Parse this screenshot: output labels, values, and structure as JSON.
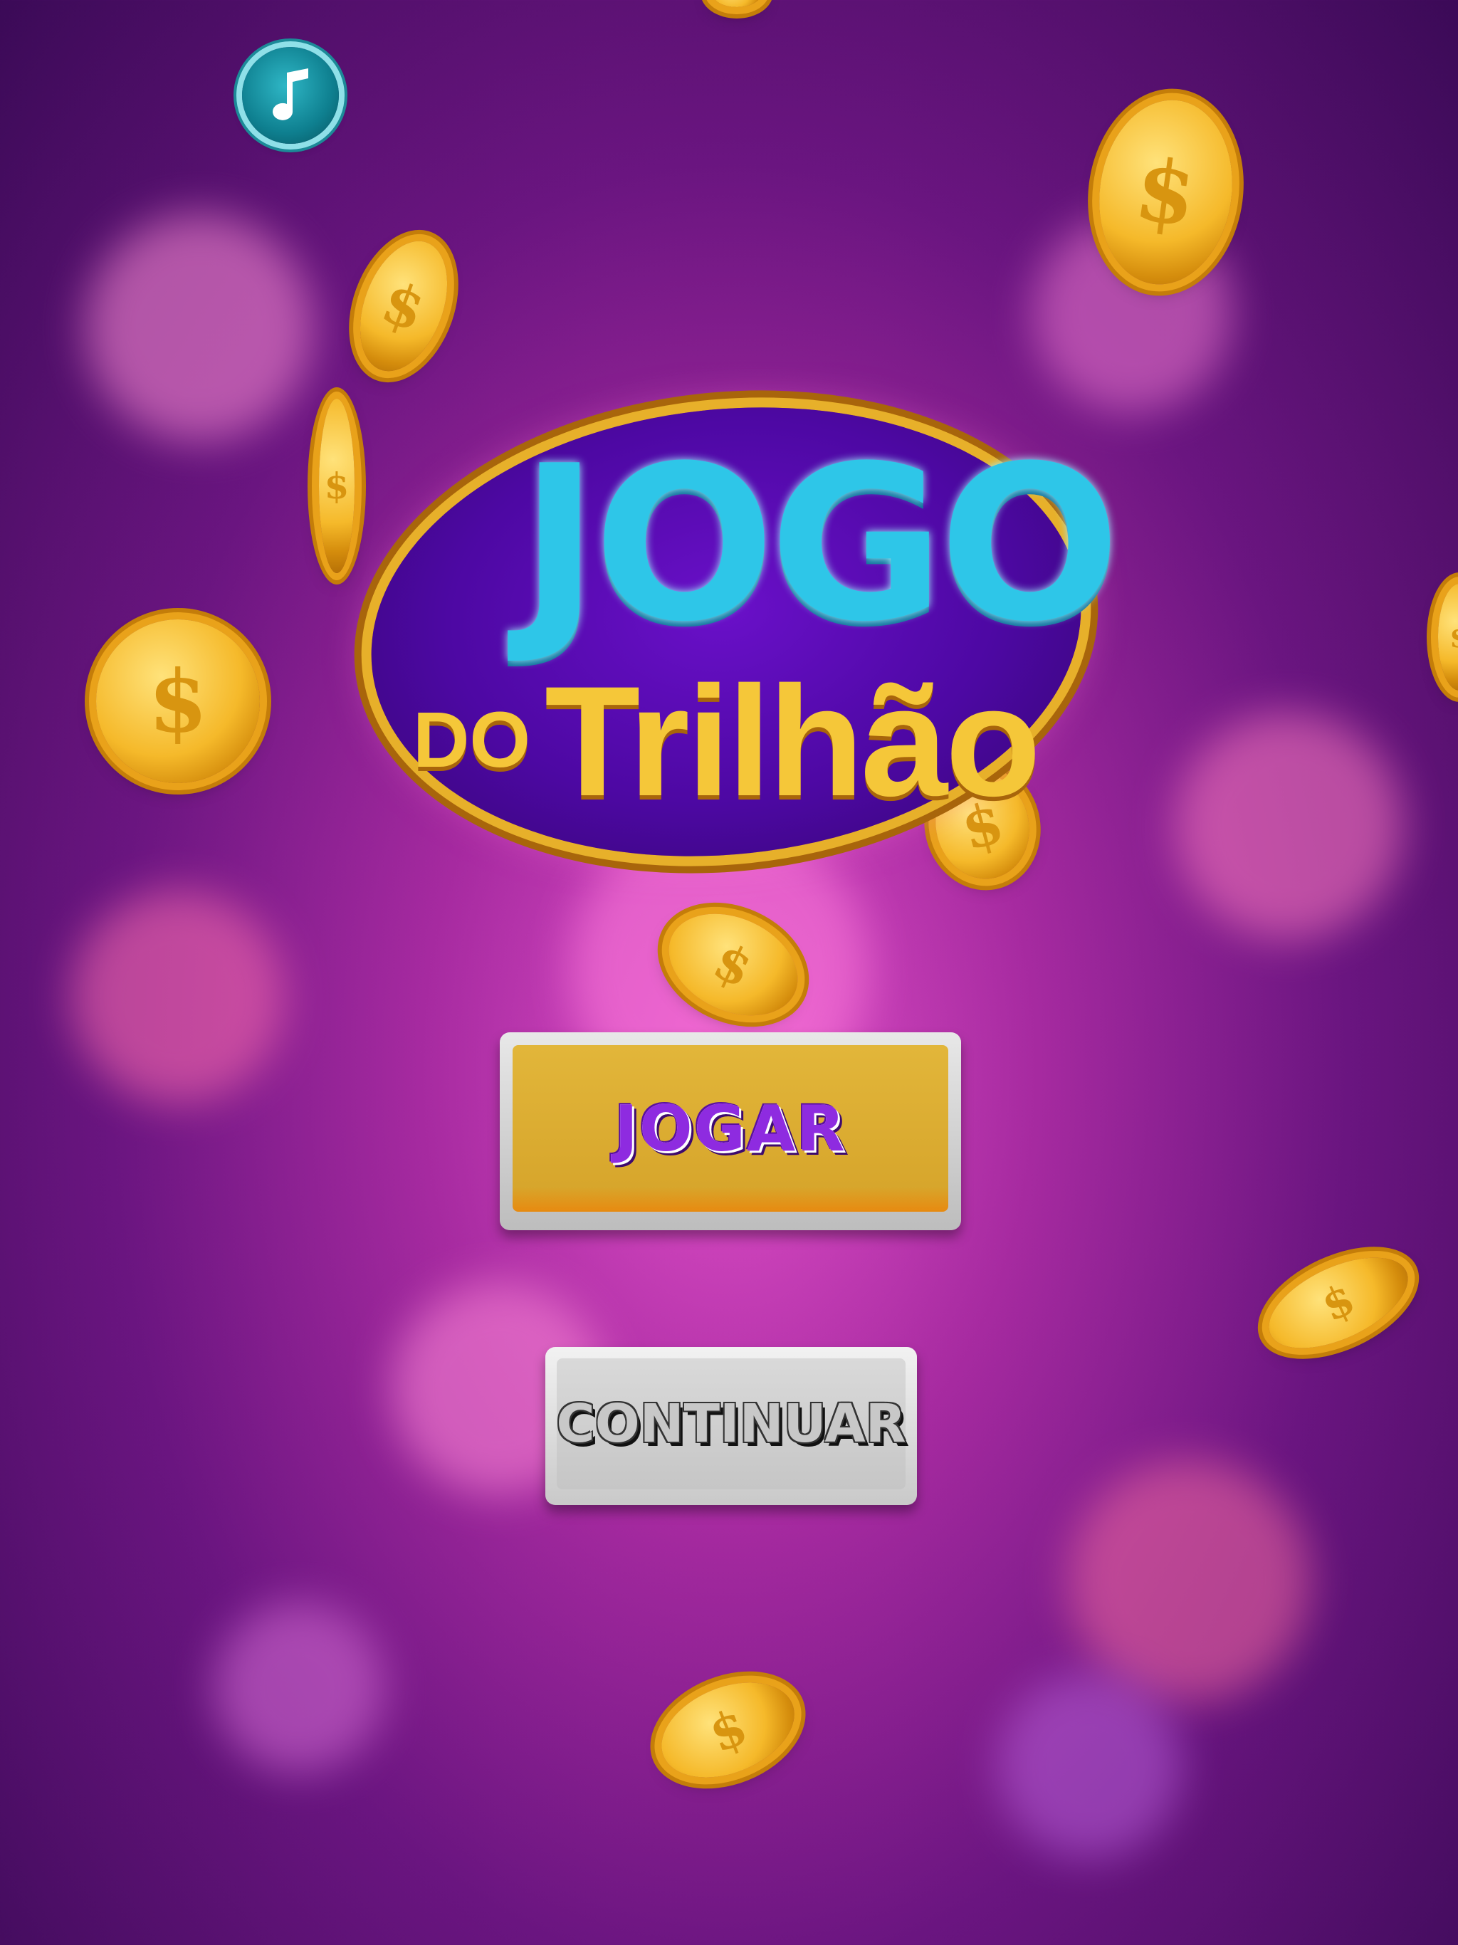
{
  "logo": {
    "line1": "JOGO",
    "line2_prefix": "DO",
    "line2_main": "Trilhão"
  },
  "buttons": {
    "play_label": "JOGAR",
    "continue_label": "CONTINUAR"
  },
  "icons": {
    "music": "music-note-icon",
    "coin": "dollar-coin-icon"
  },
  "colors": {
    "background": "#8a1d93",
    "logo_blue": "#2ec6e8",
    "logo_gold": "#f5c739",
    "play_button": "#d7a62c",
    "play_text": "#8e2be0",
    "continue_button": "#cfcfcf",
    "music_button": "#0e7f8f"
  }
}
